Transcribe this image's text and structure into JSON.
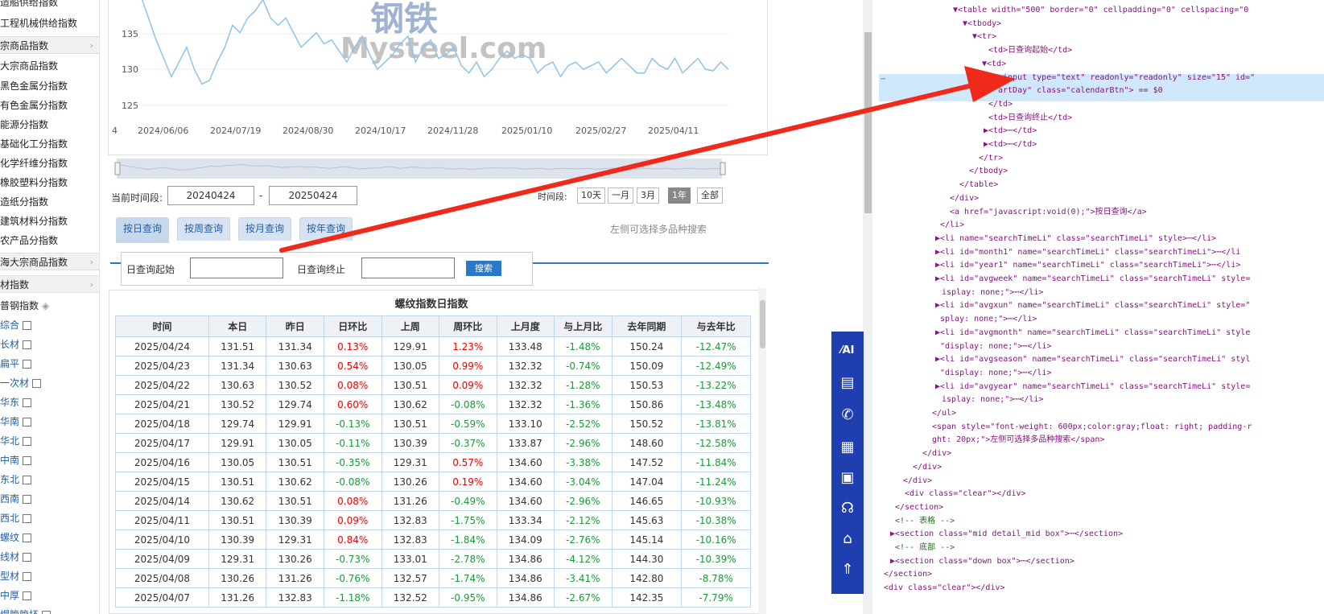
{
  "nav": {
    "items": [
      {
        "label": "造船供给指数",
        "type": "item"
      },
      {
        "label": "工程机械供给指数",
        "type": "item"
      },
      {
        "label": "宗商品指数",
        "type": "section"
      },
      {
        "label": "大宗商品指数",
        "type": "item"
      },
      {
        "label": "黑色金属分指数",
        "type": "item"
      },
      {
        "label": "有色金属分指数",
        "type": "item"
      },
      {
        "label": "能源分指数",
        "type": "item"
      },
      {
        "label": "基础化工分指数",
        "type": "item"
      },
      {
        "label": "化学纤维分指数",
        "type": "item"
      },
      {
        "label": "橡胶塑料分指数",
        "type": "item"
      },
      {
        "label": "造纸分指数",
        "type": "item"
      },
      {
        "label": "建筑材料分指数",
        "type": "item"
      },
      {
        "label": "农产品分指数",
        "type": "item"
      },
      {
        "label": "海大宗商品指数",
        "type": "section"
      },
      {
        "label": "材指数",
        "type": "section"
      },
      {
        "label": "普钢指数",
        "type": "head"
      },
      {
        "label": "综合",
        "type": "cb"
      },
      {
        "label": "长材",
        "type": "cb"
      },
      {
        "label": "扁平",
        "type": "cb"
      },
      {
        "label": "一次材",
        "type": "cb"
      },
      {
        "label": "华东",
        "type": "cb"
      },
      {
        "label": "华南",
        "type": "cb"
      },
      {
        "label": "华北",
        "type": "cb"
      },
      {
        "label": "中南",
        "type": "cb"
      },
      {
        "label": "东北",
        "type": "cb"
      },
      {
        "label": "西南",
        "type": "cb"
      },
      {
        "label": "西北",
        "type": "cb"
      },
      {
        "label": "螺纹",
        "type": "cb"
      },
      {
        "label": "线材",
        "type": "cb"
      },
      {
        "label": "型材",
        "type": "cb"
      },
      {
        "label": "中厚",
        "type": "cb"
      },
      {
        "label": "焊管管坯",
        "type": "cb"
      }
    ],
    "arrow": "›",
    "head_icon": "◈"
  },
  "chart": {
    "watermark": "钢铁",
    "watermark2": "Mysteel.com"
  },
  "chart_data": {
    "type": "line",
    "yticks": [
      "135",
      "130",
      "125"
    ],
    "xticks": [
      "4",
      "2024/06/06",
      "2024/07/19",
      "2024/08/30",
      "2024/10/17",
      "2024/11/28",
      "2025/01/10",
      "2025/02/27",
      "2025/04/11"
    ],
    "ylim": [
      123,
      140
    ],
    "y": [
      140,
      137,
      134,
      131.5,
      129,
      131,
      133,
      130,
      128,
      128.5,
      131,
      133,
      136,
      135,
      137,
      138,
      139.5,
      137,
      136,
      137,
      135,
      133,
      134,
      135,
      133.5,
      134,
      132.5,
      131,
      133,
      134.5,
      132,
      130,
      131,
      132,
      133.5,
      134.5,
      131,
      133,
      134,
      131.5,
      132,
      133,
      130.5,
      129.5,
      131,
      129,
      130,
      131.5,
      132.5,
      131.5,
      132,
      131.5,
      129.5,
      130.5,
      131,
      129,
      130.5,
      131,
      130,
      130.5,
      131,
      129.5,
      130.5,
      131.5,
      130.5,
      129.5,
      129.5,
      131.5,
      130.5,
      130,
      131.5,
      129.5,
      130.5,
      131.5,
      130,
      129.8,
      131,
      130
    ]
  },
  "range": {
    "label": "当前时间段:",
    "start": "20240424",
    "sep": "-",
    "end": "20250424",
    "period_label": "时间段:",
    "buttons": [
      "10天",
      "一月",
      "3月",
      "1年",
      "全部"
    ],
    "active": "1年"
  },
  "query": {
    "tabs": [
      "按日查询",
      "按周查询",
      "按月查询",
      "按年查询"
    ],
    "hint": "左侧可选择多品种搜索",
    "start_label": "日查询起始",
    "end_label": "日查询终止",
    "search": "搜索"
  },
  "table": {
    "title": "螺纹指数日指数",
    "headers": [
      "时间",
      "本日",
      "昨日",
      "日环比",
      "上周",
      "周环比",
      "上月度",
      "与上月比",
      "去年同期",
      "与去年比"
    ],
    "rows": [
      [
        "2025/04/24",
        "131.51",
        "131.34",
        "0.13%",
        "129.91",
        "1.23%",
        "133.48",
        "-1.48%",
        "150.24",
        "-12.47%"
      ],
      [
        "2025/04/23",
        "131.34",
        "130.63",
        "0.54%",
        "130.05",
        "0.99%",
        "132.32",
        "-0.74%",
        "150.09",
        "-12.49%"
      ],
      [
        "2025/04/22",
        "130.63",
        "130.52",
        "0.08%",
        "130.51",
        "0.09%",
        "132.32",
        "-1.28%",
        "150.53",
        "-13.22%"
      ],
      [
        "2025/04/21",
        "130.52",
        "129.74",
        "0.60%",
        "130.62",
        "-0.08%",
        "132.32",
        "-1.36%",
        "150.86",
        "-13.48%"
      ],
      [
        "2025/04/18",
        "129.74",
        "129.91",
        "-0.13%",
        "130.51",
        "-0.59%",
        "133.10",
        "-2.52%",
        "150.52",
        "-13.81%"
      ],
      [
        "2025/04/17",
        "129.91",
        "130.05",
        "-0.11%",
        "130.39",
        "-0.37%",
        "133.87",
        "-2.96%",
        "148.60",
        "-12.58%"
      ],
      [
        "2025/04/16",
        "130.05",
        "130.51",
        "-0.35%",
        "129.31",
        "0.57%",
        "134.60",
        "-3.38%",
        "147.52",
        "-11.84%"
      ],
      [
        "2025/04/15",
        "130.51",
        "130.62",
        "-0.08%",
        "130.26",
        "0.19%",
        "134.60",
        "-3.04%",
        "147.04",
        "-11.24%"
      ],
      [
        "2025/04/14",
        "130.62",
        "130.51",
        "0.08%",
        "131.26",
        "-0.49%",
        "134.60",
        "-2.96%",
        "146.65",
        "-10.93%"
      ],
      [
        "2025/04/11",
        "130.51",
        "130.39",
        "0.09%",
        "132.83",
        "-1.75%",
        "133.34",
        "-2.12%",
        "145.63",
        "-10.38%"
      ],
      [
        "2025/04/10",
        "130.39",
        "129.31",
        "0.84%",
        "132.83",
        "-1.84%",
        "134.09",
        "-2.76%",
        "145.14",
        "-10.16%"
      ],
      [
        "2025/04/09",
        "129.31",
        "130.26",
        "-0.73%",
        "133.01",
        "-2.78%",
        "134.86",
        "-4.12%",
        "144.30",
        "-10.39%"
      ],
      [
        "2025/04/08",
        "130.26",
        "131.26",
        "-0.76%",
        "132.57",
        "-1.74%",
        "134.86",
        "-3.41%",
        "142.80",
        "-8.78%"
      ],
      [
        "2025/04/07",
        "131.26",
        "132.83",
        "-1.18%",
        "132.52",
        "-0.95%",
        "134.86",
        "-2.67%",
        "142.35",
        "-7.79%"
      ]
    ]
  },
  "toolbar": {
    "items": [
      {
        "icon": "ai-icon",
        "glyph": "⁄AI"
      },
      {
        "icon": "document-icon",
        "glyph": "▤"
      },
      {
        "icon": "chat-icon",
        "glyph": "✆"
      },
      {
        "icon": "gift-icon",
        "glyph": "▦"
      },
      {
        "icon": "calendar-icon",
        "glyph": "▣"
      },
      {
        "icon": "headset-icon",
        "glyph": "☊"
      },
      {
        "icon": "building-icon",
        "glyph": "⌂"
      },
      {
        "icon": "top-icon",
        "glyph": "⇑"
      }
    ]
  },
  "devtools": {
    "lines": [
      {
        "t": "▼<table width=\"500\" border=\"0\" cellpadding=\"0\" cellspacing=\"0"
      },
      {
        "t": "▼<tbody>"
      },
      {
        "t": "▼<tr>"
      },
      {
        "t": "<td>日查询起始</td>"
      },
      {
        "t": "▼<td>"
      },
      {
        "t": "<input type=\"text\" readonly=\"readonly\" size=\"15\" id=\""
      },
      {
        "t": "artDay\" class=\"calendarBtn\"> == $0"
      },
      {
        "t": "</td>"
      },
      {
        "t": "<td>日查询终止</td>"
      },
      {
        "t": "▶<td>⋯</td>"
      },
      {
        "t": "▶<td>⋯</td>"
      },
      {
        "t": "</tr>"
      },
      {
        "t": "</tbody>"
      },
      {
        "t": "</table>"
      },
      {
        "t": "</div>"
      },
      {
        "t": "<a href=\"javascript:void(0);\">按日查询</a>"
      },
      {
        "t": "</li>"
      },
      {
        "t": "▶<li name=\"searchTimeLi\" class=\"searchTimeLi\" style>⋯</li>"
      },
      {
        "t": "▶<li id=\"month1\" name=\"searchTimeLi\" class=\"searchTimeLi\">⋯</li"
      },
      {
        "t": "▶<li id=\"year1\" name=\"searchTimeLi\" class=\"searchTimeLi\">⋯</li>"
      },
      {
        "t": "▶<li id=\"avgweek\" name=\"searchTimeLi\" class=\"searchTimeLi\" style="
      },
      {
        "t": "isplay: none;\">⋯</li>"
      },
      {
        "t": "▶<li id=\"avgxun\" name=\"searchTimeLi\" class=\"searchTimeLi\" style=\""
      },
      {
        "t": "splay: none;\">⋯</li>"
      },
      {
        "t": "▶<li id=\"avgmonth\" name=\"searchTimeLi\" class=\"searchTimeLi\" style"
      },
      {
        "t": "\"display: none;\">⋯</li>"
      },
      {
        "t": "▶<li id=\"avgseason\" name=\"searchTimeLi\" class=\"searchTimeLi\" styl"
      },
      {
        "t": "\"display: none;\">⋯</li>"
      },
      {
        "t": "▶<li id=\"avgyear\" name=\"searchTimeLi\" class=\"searchTimeLi\" style="
      },
      {
        "t": "isplay: none;\">⋯</li>"
      },
      {
        "t": "</ul>"
      },
      {
        "t": "<span style=\"font-weight: 600px;color:gray;float: right; padding-r"
      },
      {
        "t": "ght: 20px;\">左侧可选择多品种搜索</span>"
      },
      {
        "t": "</div>"
      },
      {
        "t": "</div>"
      },
      {
        "t": "</div>"
      },
      {
        "t": "<div class=\"clear\"></div>"
      },
      {
        "t": "</section>"
      },
      {
        "t": "<!-- 表格 -->"
      },
      {
        "t": "▶<section class=\"mid detail_mid box\">⋯</section>"
      },
      {
        "t": "<!-- 底部 -->"
      },
      {
        "t": "▶<section class=\"down box\">⋯</section>"
      },
      {
        "t": "</section>"
      },
      {
        "t": "<div class=\"clear\"></div>"
      }
    ],
    "dots": "⋯"
  }
}
